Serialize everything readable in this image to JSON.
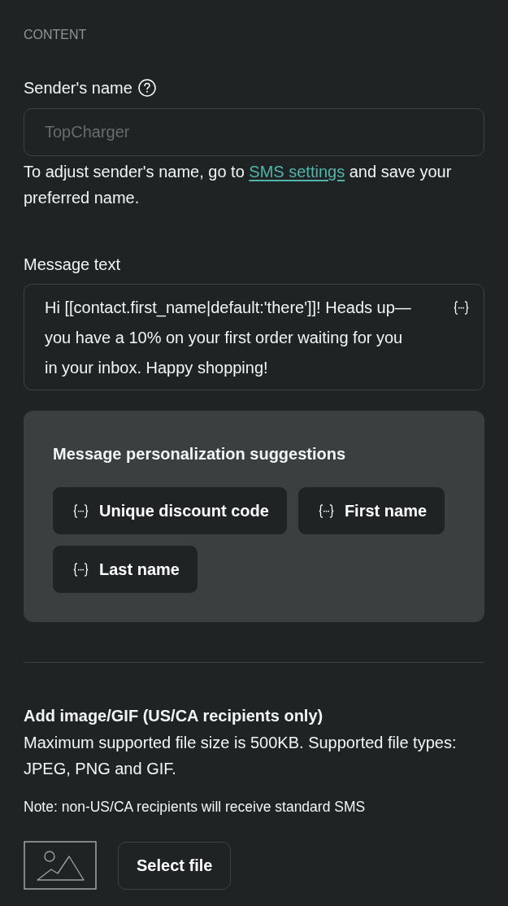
{
  "section_title": "CONTENT",
  "sender_name": {
    "label": "Sender's name",
    "placeholder": "TopCharger",
    "hint": {
      "before": "To adjust sender's name, go to ",
      "link": "SMS settings",
      "after": " and save your preferred name."
    }
  },
  "message_text": {
    "label": "Message text",
    "value": "Hi [[contact.first_name|default:'there']]! Heads up—you have a 10% on your first order waiting for you in your inbox. Happy shopping!"
  },
  "personalization": {
    "title": "Message personalization suggestions",
    "suggestions": [
      "Unique discount code",
      "First name",
      "Last name"
    ]
  },
  "image_upload": {
    "title": "Add image/GIF (US/CA recipients only)",
    "description": "Maximum supported file size is 500KB. Supported file types: JPEG, PNG and GIF.",
    "note": "Note: non-US/CA recipients will receive standard SMS",
    "button": "Select file"
  }
}
